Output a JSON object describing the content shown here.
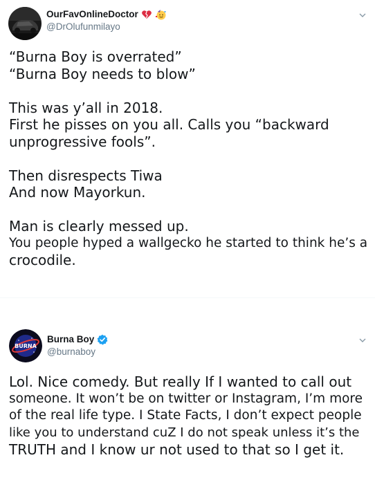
{
  "tweets": [
    {
      "display_name": "OurFavOnlineDoctor",
      "handle": "@DrOlufunmilayo",
      "name_emojis": [
        "broken-heart",
        "partying-face"
      ],
      "text_lines": [
        "“Burna Boy is overrated”",
        "“Burna Boy needs to blow”",
        "",
        "This was y’all in 2018.",
        "First he pisses on you all. Calls you “backward",
        "unprogressive fools”.",
        "",
        "Then disrespects Tiwa",
        "And now Mayorkun.",
        "",
        "Man is clearly messed up.",
        "You people hyped a wallgecko he started to think he’s a",
        "crocodile."
      ]
    },
    {
      "display_name": "Burna Boy",
      "handle": "@burnaboy",
      "verified": true,
      "avatar_text": "BURNA",
      "text_lines": [
        "Lol. Nice comedy. But really If I wanted to call out",
        "someone. It won’t be on twitter or Instagram, I’m more",
        "of the real life type. I State Facts, I don’t expect people",
        "like you to understand cuZ I do not speak unless it’s the",
        "TRUTH and I know ur not used to that so I get it."
      ]
    }
  ],
  "colors": {
    "text": "#14171a",
    "secondary": "#657786",
    "verified": "#1da1f2"
  }
}
